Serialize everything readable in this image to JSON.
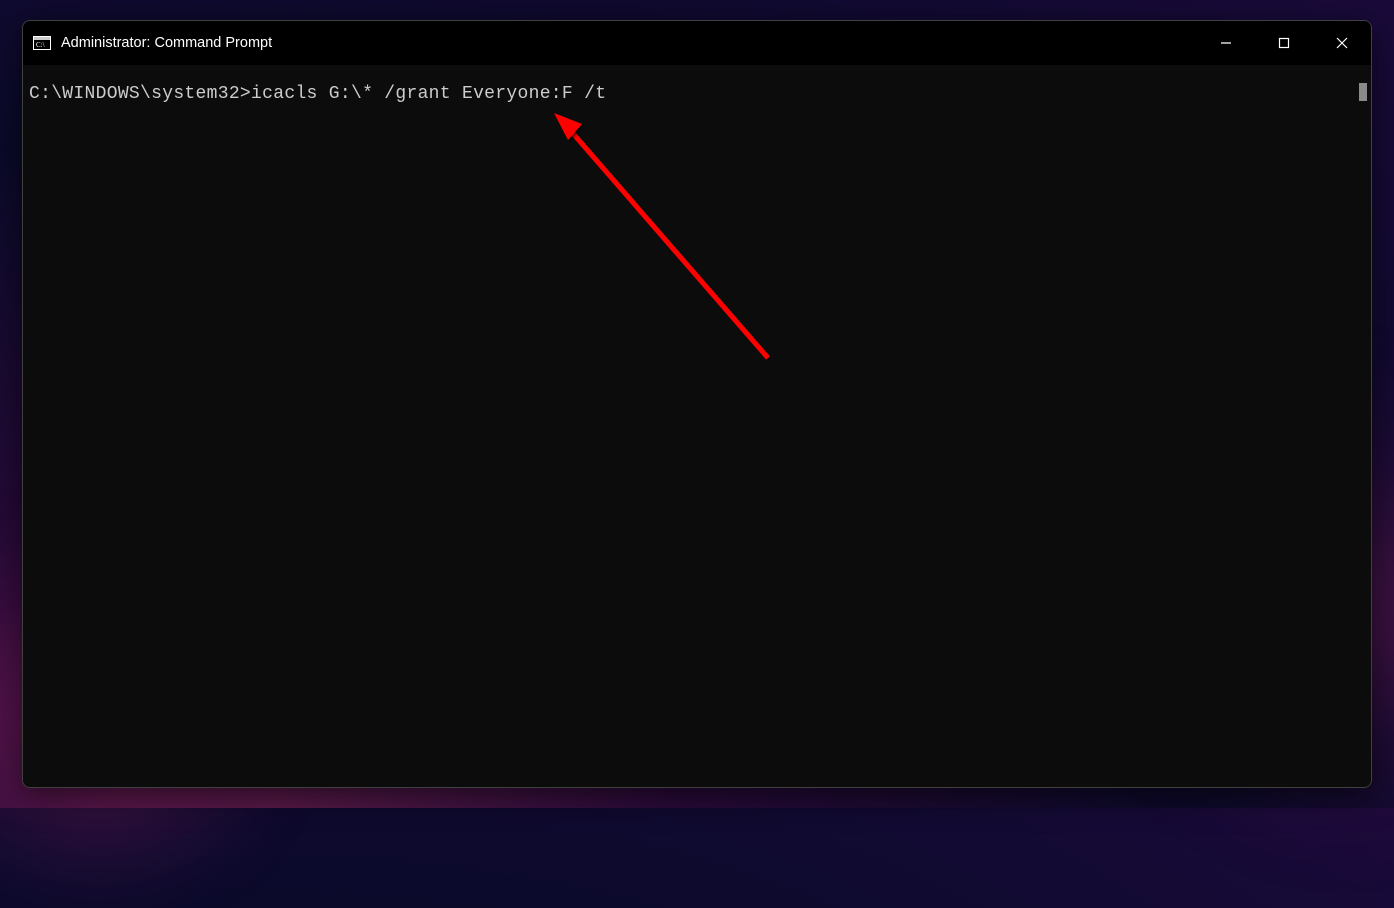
{
  "window": {
    "title": "Administrator: Command Prompt"
  },
  "terminal": {
    "prompt": "C:\\WINDOWS\\system32>",
    "command": "icacls G:\\* /grant Everyone:F /t"
  }
}
